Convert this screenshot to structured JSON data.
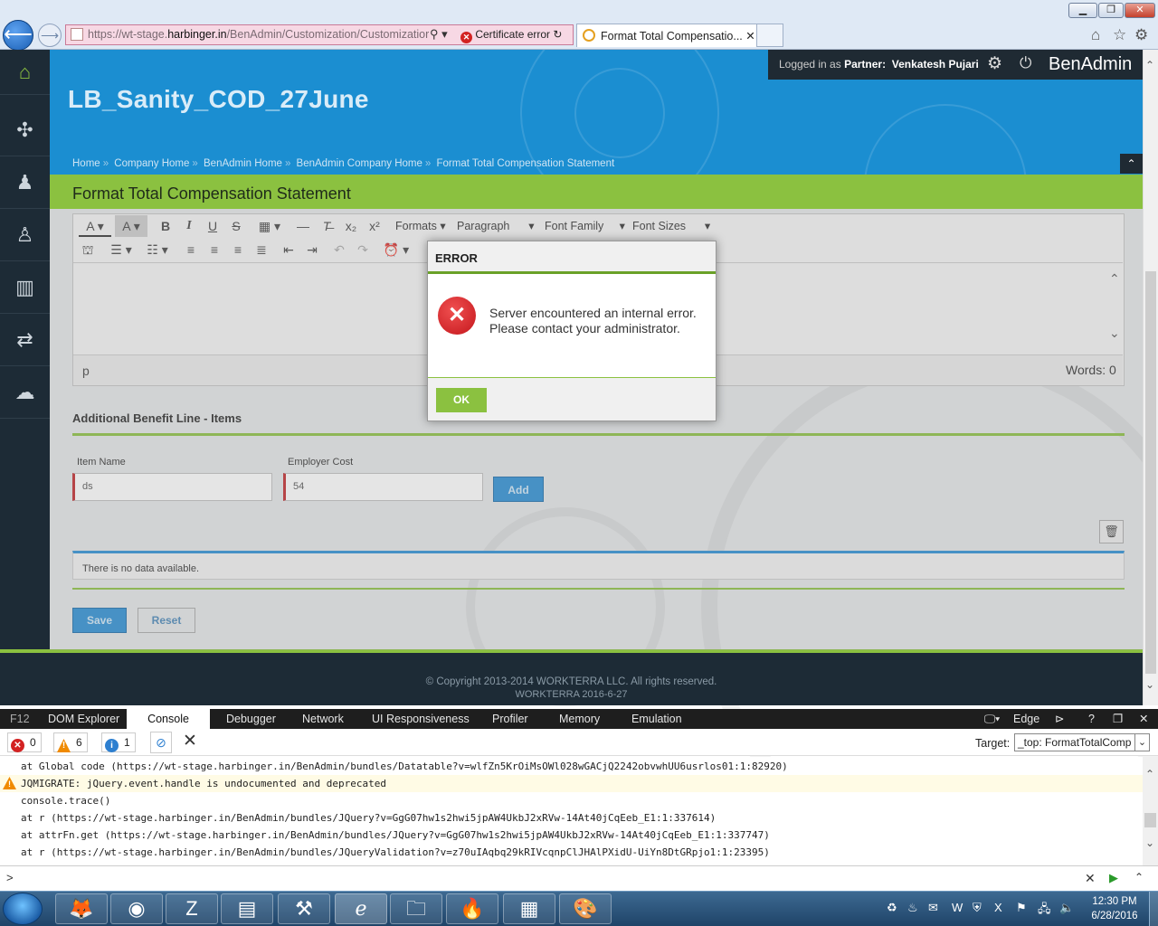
{
  "browser": {
    "address_prefix": "https://wt-stage.",
    "address_host": "harbinger.in",
    "address_path": "/BenAdmin/Customization/Customizatior",
    "cert_error": "Certificate error",
    "tab_title": "Format Total Compensatio...",
    "tab_close": "✕",
    "win_min": "▁",
    "win_max": "❐",
    "win_close": "✕"
  },
  "app": {
    "company_title": "LB_Sanity_COD_27June",
    "breadcrumb": [
      "Home",
      "Company Home",
      "BenAdmin Home",
      "BenAdmin Company Home",
      "Format Total Compensation Statement"
    ],
    "crumb_sep": "»",
    "logged_in_prefix": "Logged in as",
    "logged_in_role": "Partner:",
    "logged_in_user": "Venkatesh Pujari",
    "brand": "BenAdmin",
    "page_title": "Format Total Compensation Statement"
  },
  "editor": {
    "formats": "Formats",
    "paragraph": "Paragraph",
    "font_family": "Font Family",
    "font_sizes": "Font Sizes",
    "path": "p",
    "words": "Words: 0"
  },
  "section": {
    "title": "Additional Benefit Line - Items",
    "item_name_label": "Item Name",
    "item_name_value": "ds",
    "employer_cost_label": "Employer Cost",
    "employer_cost_value": "54",
    "add": "Add",
    "no_data": "There is no data available.",
    "save": "Save",
    "reset": "Reset"
  },
  "footer": {
    "copyright": "© Copyright 2013-2014 WORKTERRA LLC. All rights reserved.",
    "version": "WORKTERRA 2016-6-27"
  },
  "modal": {
    "title": "ERROR",
    "message": "Server encountered an internal error. Please contact your administrator.",
    "ok": "OK"
  },
  "devtools": {
    "f12": "F12",
    "tabs": [
      "DOM Explorer",
      "Console",
      "Debugger",
      "Network",
      "UI Responsiveness",
      "Profiler",
      "Memory",
      "Emulation"
    ],
    "mode": "Edge",
    "errors": "0",
    "warnings": "6",
    "info": "1",
    "target_label": "Target:",
    "target_value": "_top: FormatTotalComp",
    "lines": [
      "    at Global code (https://wt-stage.harbinger.in/BenAdmin/bundles/Datatable?v=wlfZn5KrOiMsOWl028wGACjQ2242obvwhUU6usrlos01:1:82920)",
      "JQMIGRATE: jQuery.event.handle is undocumented and deprecated",
      "console.trace()",
      "    at r (https://wt-stage.harbinger.in/BenAdmin/bundles/JQuery?v=GgG07hw1s2hwi5jpAW4UkbJ2xRVw-14At40jCqEeb_E1:1:337614)",
      "    at attrFn.get (https://wt-stage.harbinger.in/BenAdmin/bundles/JQuery?v=GgG07hw1s2hwi5jpAW4UkbJ2xRVw-14At40jCqEeb_E1:1:337747)",
      "    at r (https://wt-stage.harbinger.in/BenAdmin/bundles/JQueryValidation?v=z70uIAqbq29kRIVcqnpClJHAlPXidU-UiYn8DtGRpjo1:1:23395)"
    ],
    "prompt": ">"
  },
  "taskbar": {
    "time": "12:30 PM",
    "date": "6/28/2016"
  },
  "colors": {
    "header_blue": "#1b8ed1",
    "accent_green": "#8bc140",
    "nav_dark": "#1d2b36",
    "error_red": "#c4161c"
  }
}
